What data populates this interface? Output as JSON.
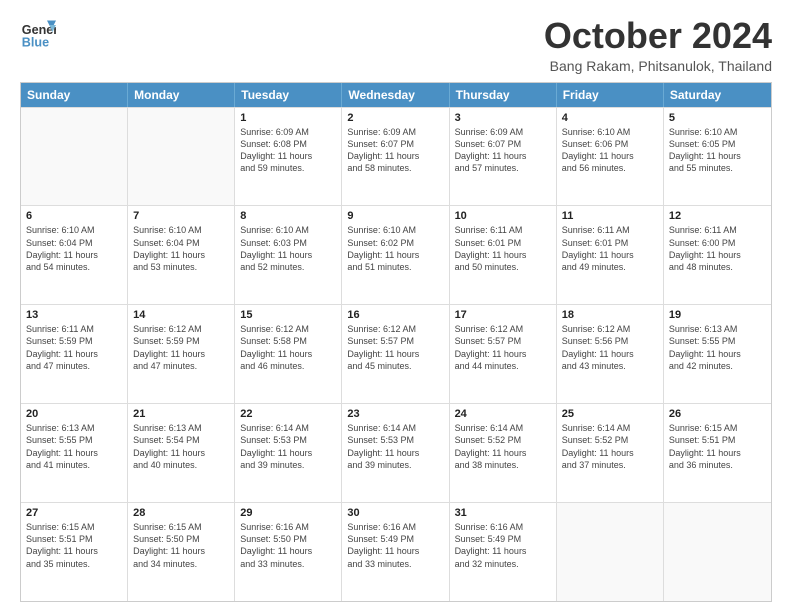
{
  "header": {
    "logo_line1": "General",
    "logo_line2": "Blue",
    "month_title": "October 2024",
    "location": "Bang Rakam, Phitsanulok, Thailand"
  },
  "weekdays": [
    "Sunday",
    "Monday",
    "Tuesday",
    "Wednesday",
    "Thursday",
    "Friday",
    "Saturday"
  ],
  "weeks": [
    [
      {
        "day": "",
        "empty": true
      },
      {
        "day": "",
        "empty": true
      },
      {
        "day": "1",
        "sunrise": "6:09 AM",
        "sunset": "6:08 PM",
        "daylight": "11 hours and 59 minutes."
      },
      {
        "day": "2",
        "sunrise": "6:09 AM",
        "sunset": "6:07 PM",
        "daylight": "11 hours and 58 minutes."
      },
      {
        "day": "3",
        "sunrise": "6:09 AM",
        "sunset": "6:07 PM",
        "daylight": "11 hours and 57 minutes."
      },
      {
        "day": "4",
        "sunrise": "6:10 AM",
        "sunset": "6:06 PM",
        "daylight": "11 hours and 56 minutes."
      },
      {
        "day": "5",
        "sunrise": "6:10 AM",
        "sunset": "6:05 PM",
        "daylight": "11 hours and 55 minutes."
      }
    ],
    [
      {
        "day": "6",
        "sunrise": "6:10 AM",
        "sunset": "6:04 PM",
        "daylight": "11 hours and 54 minutes."
      },
      {
        "day": "7",
        "sunrise": "6:10 AM",
        "sunset": "6:04 PM",
        "daylight": "11 hours and 53 minutes."
      },
      {
        "day": "8",
        "sunrise": "6:10 AM",
        "sunset": "6:03 PM",
        "daylight": "11 hours and 52 minutes."
      },
      {
        "day": "9",
        "sunrise": "6:10 AM",
        "sunset": "6:02 PM",
        "daylight": "11 hours and 51 minutes."
      },
      {
        "day": "10",
        "sunrise": "6:11 AM",
        "sunset": "6:01 PM",
        "daylight": "11 hours and 50 minutes."
      },
      {
        "day": "11",
        "sunrise": "6:11 AM",
        "sunset": "6:01 PM",
        "daylight": "11 hours and 49 minutes."
      },
      {
        "day": "12",
        "sunrise": "6:11 AM",
        "sunset": "6:00 PM",
        "daylight": "11 hours and 48 minutes."
      }
    ],
    [
      {
        "day": "13",
        "sunrise": "6:11 AM",
        "sunset": "5:59 PM",
        "daylight": "11 hours and 47 minutes."
      },
      {
        "day": "14",
        "sunrise": "6:12 AM",
        "sunset": "5:59 PM",
        "daylight": "11 hours and 47 minutes."
      },
      {
        "day": "15",
        "sunrise": "6:12 AM",
        "sunset": "5:58 PM",
        "daylight": "11 hours and 46 minutes."
      },
      {
        "day": "16",
        "sunrise": "6:12 AM",
        "sunset": "5:57 PM",
        "daylight": "11 hours and 45 minutes."
      },
      {
        "day": "17",
        "sunrise": "6:12 AM",
        "sunset": "5:57 PM",
        "daylight": "11 hours and 44 minutes."
      },
      {
        "day": "18",
        "sunrise": "6:12 AM",
        "sunset": "5:56 PM",
        "daylight": "11 hours and 43 minutes."
      },
      {
        "day": "19",
        "sunrise": "6:13 AM",
        "sunset": "5:55 PM",
        "daylight": "11 hours and 42 minutes."
      }
    ],
    [
      {
        "day": "20",
        "sunrise": "6:13 AM",
        "sunset": "5:55 PM",
        "daylight": "11 hours and 41 minutes."
      },
      {
        "day": "21",
        "sunrise": "6:13 AM",
        "sunset": "5:54 PM",
        "daylight": "11 hours and 40 minutes."
      },
      {
        "day": "22",
        "sunrise": "6:14 AM",
        "sunset": "5:53 PM",
        "daylight": "11 hours and 39 minutes."
      },
      {
        "day": "23",
        "sunrise": "6:14 AM",
        "sunset": "5:53 PM",
        "daylight": "11 hours and 39 minutes."
      },
      {
        "day": "24",
        "sunrise": "6:14 AM",
        "sunset": "5:52 PM",
        "daylight": "11 hours and 38 minutes."
      },
      {
        "day": "25",
        "sunrise": "6:14 AM",
        "sunset": "5:52 PM",
        "daylight": "11 hours and 37 minutes."
      },
      {
        "day": "26",
        "sunrise": "6:15 AM",
        "sunset": "5:51 PM",
        "daylight": "11 hours and 36 minutes."
      }
    ],
    [
      {
        "day": "27",
        "sunrise": "6:15 AM",
        "sunset": "5:51 PM",
        "daylight": "11 hours and 35 minutes."
      },
      {
        "day": "28",
        "sunrise": "6:15 AM",
        "sunset": "5:50 PM",
        "daylight": "11 hours and 34 minutes."
      },
      {
        "day": "29",
        "sunrise": "6:16 AM",
        "sunset": "5:50 PM",
        "daylight": "11 hours and 33 minutes."
      },
      {
        "day": "30",
        "sunrise": "6:16 AM",
        "sunset": "5:49 PM",
        "daylight": "11 hours and 33 minutes."
      },
      {
        "day": "31",
        "sunrise": "6:16 AM",
        "sunset": "5:49 PM",
        "daylight": "11 hours and 32 minutes."
      },
      {
        "day": "",
        "empty": true
      },
      {
        "day": "",
        "empty": true
      }
    ]
  ],
  "labels": {
    "sunrise": "Sunrise:",
    "sunset": "Sunset:",
    "daylight": "Daylight:"
  }
}
